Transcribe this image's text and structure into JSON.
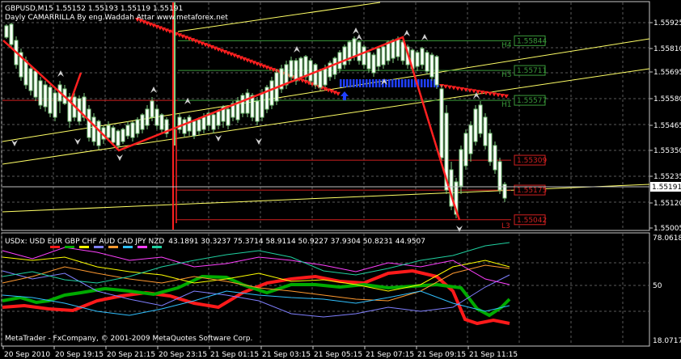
{
  "window": {
    "symbol_line": "GBPUSD,M15  1.55152 1.55193 1.55119 1.55191",
    "indicator_title": "Dayly CAMARRILLA By eng.Waddah Attar www.metaforex.net",
    "copyright": "MetaTrader - FxCompany, © 2001-2009 MetaQuotes Software Corp."
  },
  "colors": {
    "background": "#000000",
    "grid": "#5a5a5a",
    "bull_candle": "#ffffff",
    "bear_candle": "#000000",
    "candle_wick": "#7fcc7f",
    "zigzag": "#ff2020",
    "channel": "#ffff66",
    "level_h": "#3a9a3a",
    "level_l": "#d02020",
    "price_line": "#c0c0c0",
    "arrow_red": "#ff2020",
    "arrow_blue": "#2040ff"
  },
  "price_axis": {
    "labels": [
      "1.55925",
      "1.55810",
      "1.55695",
      "1.55580",
      "1.55465",
      "1.55350",
      "1.55235",
      "1.55120",
      "1.55005"
    ],
    "current": "1.55191"
  },
  "levels": [
    {
      "id": "H4",
      "value": "1.55844",
      "tag": "H4",
      "kind": "h",
      "price": 1.55844
    },
    {
      "id": "H3",
      "value": "1.55711",
      "tag": "H3",
      "kind": "h",
      "price": 1.55711
    },
    {
      "id": "H1",
      "value": "1.55577",
      "tag": "H1",
      "kind": "h",
      "price": 1.55577
    },
    {
      "id": "L1",
      "value": "1.55309",
      "tag": "",
      "kind": "l",
      "price": 1.55309
    },
    {
      "id": "L2",
      "value": "1.55175",
      "tag": "",
      "kind": "l",
      "price": 1.55175
    },
    {
      "id": "L3",
      "value": "1.55042",
      "tag": "L3",
      "kind": "l",
      "price": 1.55042
    }
  ],
  "time_axis": [
    "20 Sep 2010",
    "20 Sep 19:15",
    "20 Sep 21:15",
    "20 Sep 23:15",
    "21 Sep 01:15",
    "21 Sep 03:15",
    "21 Sep 05:15",
    "21 Sep 07:15",
    "21 Sep 09:15",
    "21 Sep 11:15"
  ],
  "indicator": {
    "label": "USDx",
    "currencies": [
      {
        "name": "USD",
        "color": "#ff1a1a"
      },
      {
        "name": "EUR",
        "color": "#00aa00"
      },
      {
        "name": "GBP",
        "color": "#ffff00"
      },
      {
        "name": "CHF",
        "color": "#8080ff"
      },
      {
        "name": "AUD",
        "color": "#ff9a30"
      },
      {
        "name": "CAD",
        "color": "#30c0ff"
      },
      {
        "name": "JPY",
        "color": "#ff40ff"
      },
      {
        "name": "NZD",
        "color": "#20d0a0"
      }
    ],
    "values_text": "43.1891 30.3237 75.3714 58.9114 50.9227 37.9304 50.8231 44.9507",
    "axis": [
      "78.0618",
      "50",
      "18.0717"
    ]
  }
}
